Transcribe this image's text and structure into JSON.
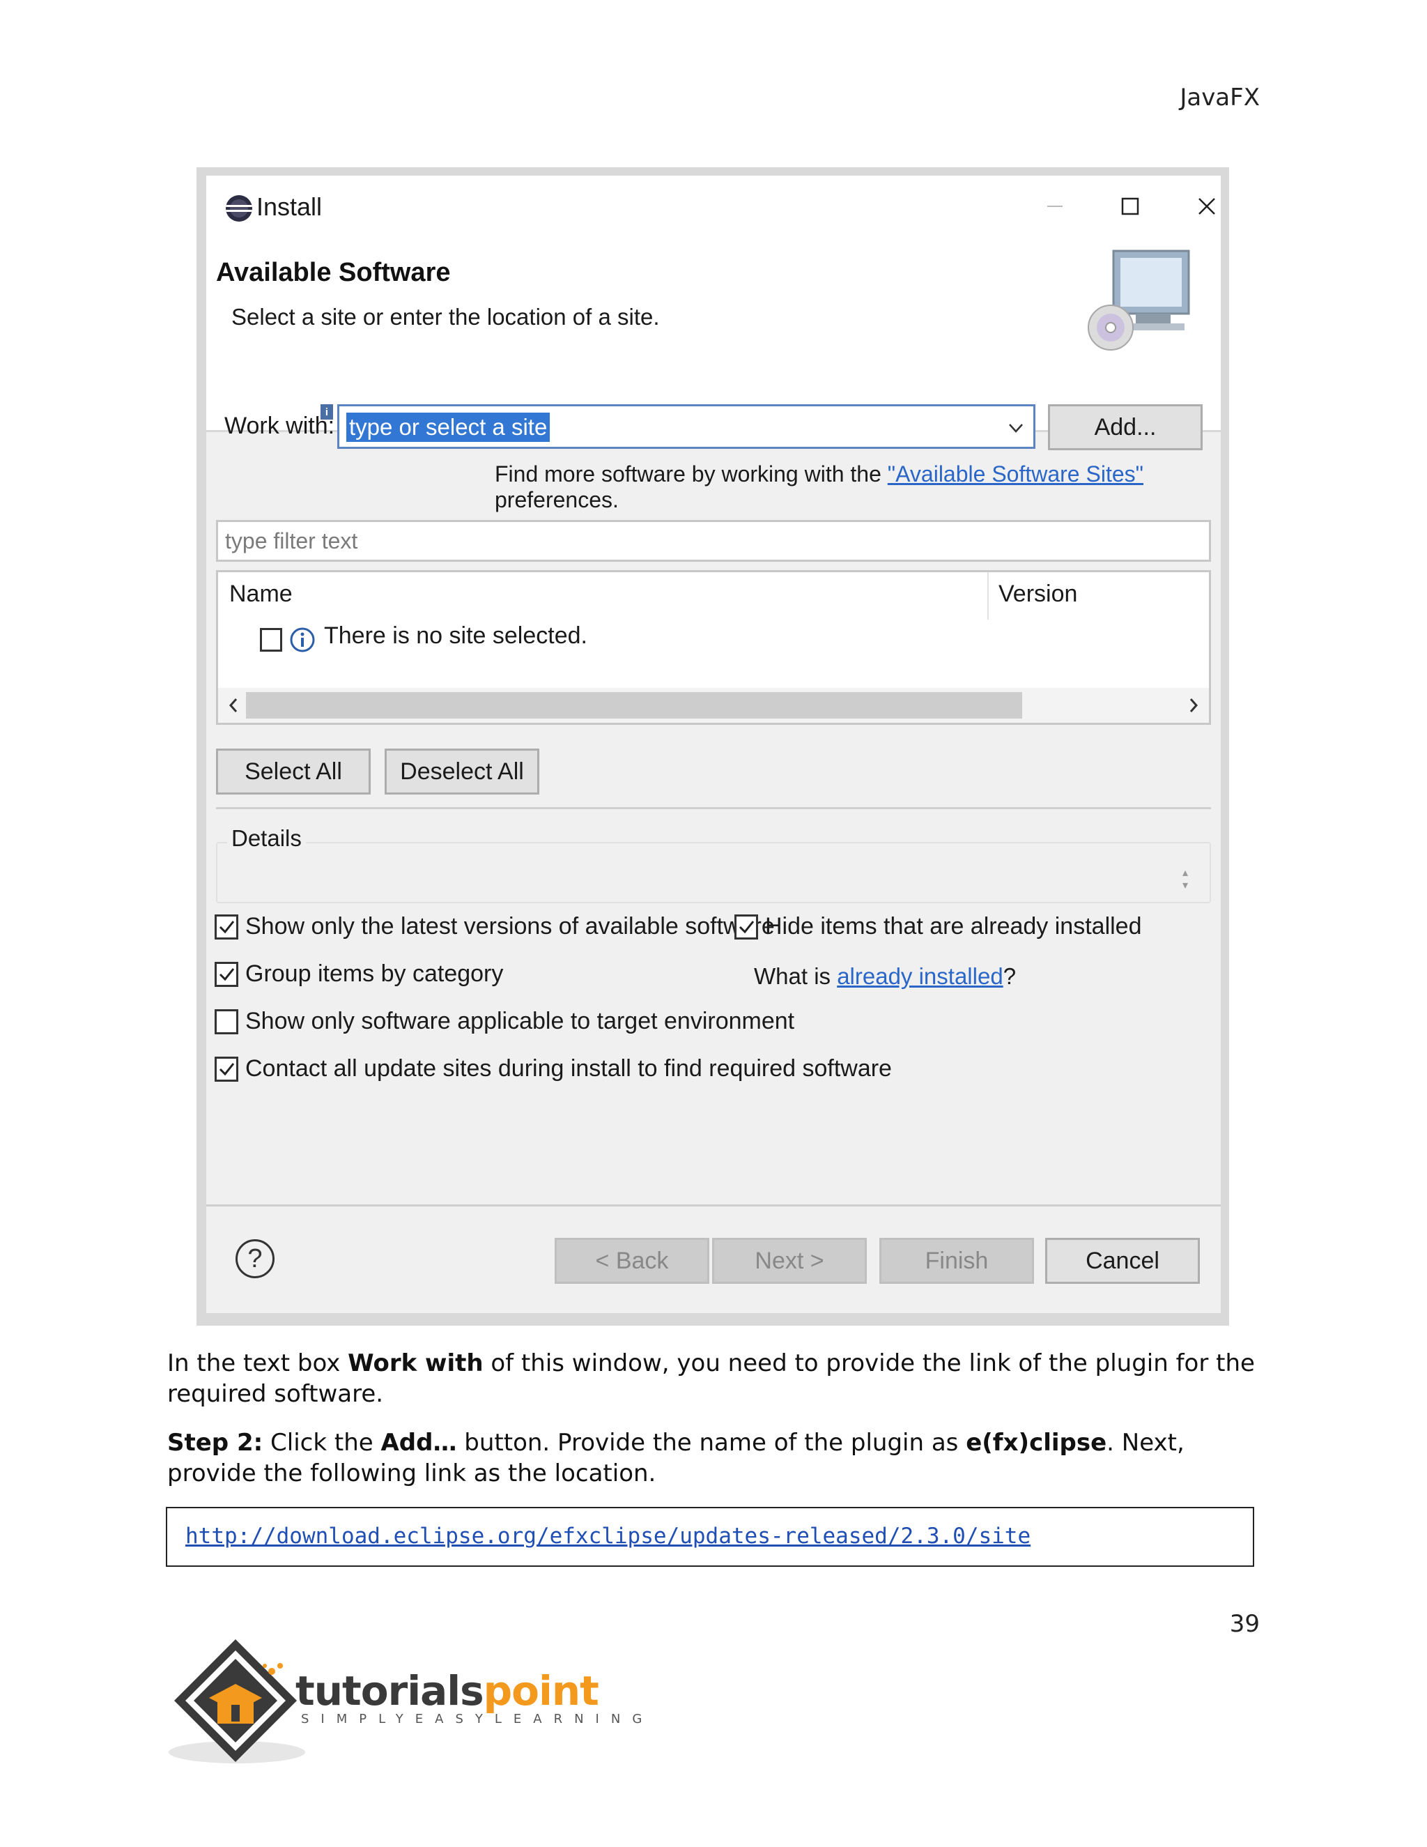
{
  "header": {
    "title": "JavaFX"
  },
  "dialog": {
    "window_title": "Install",
    "banner_title": "Available Software",
    "banner_subtitle": "Select a site or enter the location of a site.",
    "work_with_label": "Work with:",
    "info_badge": "i",
    "work_with_value": "type or select a site",
    "add_button": "Add...",
    "find_more_prefix": "Find more software by working with the ",
    "find_more_link": "\"Available Software Sites\"",
    "find_more_suffix": " preferences.",
    "filter_placeholder": "type filter text",
    "table": {
      "columns": [
        "Name",
        "Version"
      ],
      "rows": [
        {
          "name": "There is no site selected.",
          "checked": false
        }
      ]
    },
    "select_all_button": "Select All",
    "deselect_all_button": "Deselect All",
    "details_label": "Details",
    "options": {
      "latest_versions": "Show only the latest versions of available software",
      "group_by_category": "Group items by category",
      "applicable_target": "Show only software applicable to target environment",
      "contact_all_sites": "Contact all update sites during install to find required software",
      "hide_installed": "Hide items that are already installed"
    },
    "option_states": {
      "latest_versions": true,
      "group_by_category": true,
      "applicable_target": false,
      "contact_all_sites": true,
      "hide_installed": true
    },
    "what_is_prefix": "What is ",
    "what_is_link": "already installed",
    "what_is_suffix": "?",
    "help_icon": "?",
    "back_button": "< Back",
    "next_button": "Next >",
    "finish_button": "Finish",
    "cancel_button": "Cancel"
  },
  "body": {
    "para1_a": "In the text box ",
    "para1_b": "Work with",
    "para1_c": " of this window, you need to provide the link of the plugin for the required software.",
    "para2_a": "Step 2:",
    "para2_b": " Click the ",
    "para2_c": "Add…",
    "para2_d": " button. Provide the name of the plugin as ",
    "para2_e": "e(fx)clipse",
    "para2_f": ". Next, provide the following link as the location.",
    "url": "http://download.eclipse.org/efxclipse/updates-released/2.3.0/site"
  },
  "page_number": "39",
  "logo": {
    "word_a": "tutorials",
    "word_b": "point",
    "tagline": "SIMPLYEASYLEARNING"
  },
  "colors": {
    "link": "#2a66c8",
    "selection": "#3277d3",
    "logo_orange": "#f39a1e"
  }
}
